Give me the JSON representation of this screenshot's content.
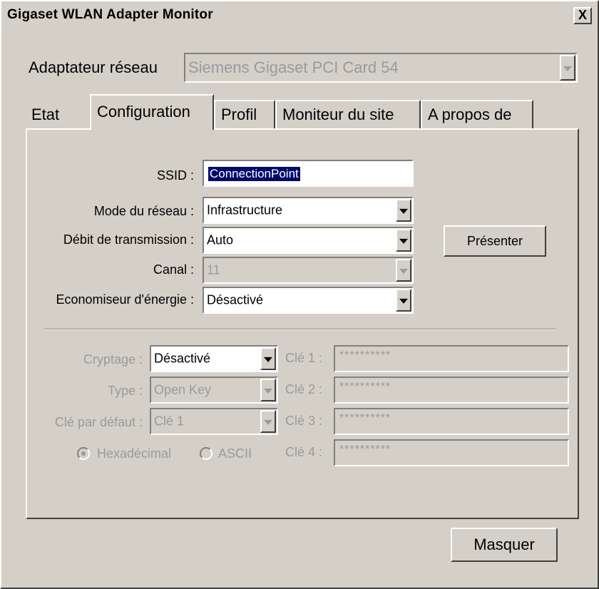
{
  "window": {
    "title": "Gigaset WLAN Adapter Monitor",
    "close_label": "X"
  },
  "adapter": {
    "label": "Adaptateur réseau",
    "value": "Siemens Gigaset PCI Card 54"
  },
  "tabs": [
    {
      "label": "Etat"
    },
    {
      "label": "Configuration"
    },
    {
      "label": "Profil"
    },
    {
      "label": "Moniteur du site"
    },
    {
      "label": "A propos de"
    }
  ],
  "config": {
    "ssid_label": "SSID :",
    "ssid_value": "ConnectionPoint",
    "mode_label": "Mode du réseau :",
    "mode_value": "Infrastructure",
    "rate_label": "Débit de transmission :",
    "rate_value": "Auto",
    "channel_label": "Canal :",
    "channel_value": "11",
    "power_label": "Economiseur d'énergie :",
    "power_value": "Désactivé",
    "present_button": "Présenter"
  },
  "security": {
    "crypt_label": "Cryptage :",
    "crypt_value": "Désactivé",
    "type_label": "Type :",
    "type_value": "Open Key",
    "default_key_label": "Clé par défaut :",
    "default_key_value": "Clé 1",
    "hex_label": "Hexadécimal",
    "ascii_label": "ASCII",
    "keys": [
      {
        "label": "Clé 1 :",
        "value": "**********"
      },
      {
        "label": "Clé 2 :",
        "value": "**********"
      },
      {
        "label": "Clé 3 :",
        "value": "**********"
      },
      {
        "label": "Clé 4 :",
        "value": "**********"
      }
    ]
  },
  "footer": {
    "hide_button": "Masquer"
  }
}
